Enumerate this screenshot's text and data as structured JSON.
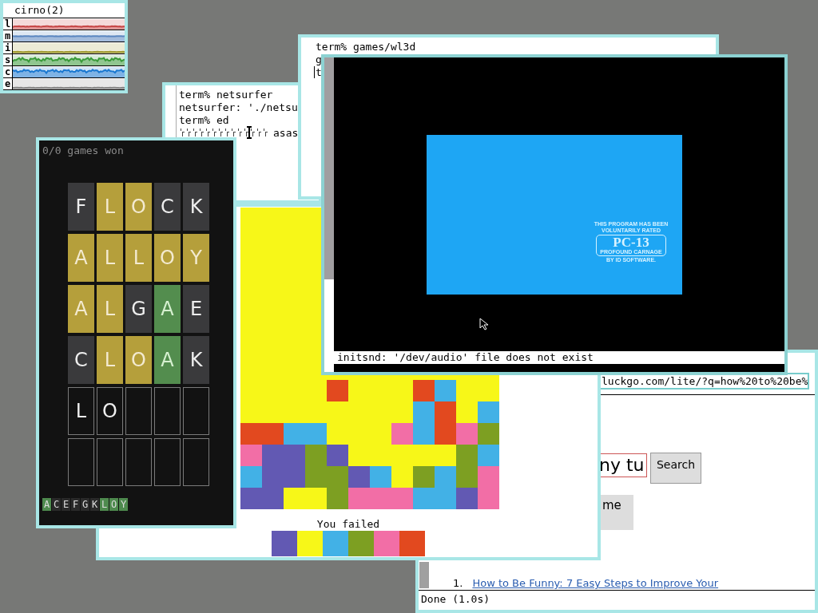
{
  "stats": {
    "title": "cirno(2)",
    "rows": [
      {
        "label": "l",
        "color": "#c84848"
      },
      {
        "label": "m",
        "color": "#5a86c0"
      },
      {
        "label": "i",
        "color": "#a09a30"
      },
      {
        "label": "s",
        "color": "#3a9a3a"
      },
      {
        "label": "c",
        "color": "#1a78d0"
      },
      {
        "label": "e",
        "color": "#888888"
      }
    ]
  },
  "terminals": [
    {
      "lines": [
        {
          "text": "term% netsurfer",
          "kind": "text"
        },
        {
          "text": "netsurfer: './netsu",
          "kind": "text"
        },
        {
          "text": "term% ed",
          "kind": "text"
        },
        {
          "text": "asas",
          "kind": "garbled",
          "cursor": true
        }
      ]
    },
    {
      "lines": [
        {
          "text": "term% games/wl3d",
          "kind": "text"
        },
        {
          "text": "g",
          "kind": "text"
        },
        {
          "text": "t",
          "kind": "text",
          "cursor": true
        }
      ]
    }
  ],
  "browser": {
    "url": "luckgo.com/lite/?q=how%20to%20be%",
    "search_value": "ny tu",
    "search_button": "Search",
    "button_2": "me",
    "results": [
      {
        "number": "1.",
        "title": "How to Be Funny: 7 Easy Steps to Improve Your"
      }
    ],
    "status": "Done (1.0s)"
  },
  "flood": {
    "board": {
      "color": "#f7f718",
      "rows": [
        [
          null,
          null,
          null,
          null,
          {
            "color": "#e2491f"
          },
          null,
          null,
          null,
          {
            "color": "#e2491f"
          },
          {
            "color": "#42b1e6"
          },
          null,
          null
        ],
        [
          null,
          null,
          null,
          null,
          null,
          null,
          null,
          null,
          {
            "color": "#42b1e6"
          },
          {
            "color": "#e2491f"
          },
          null,
          {
            "color": "#42b1e6"
          }
        ],
        [
          {
            "color": "#e2491f"
          },
          {
            "color": "#e2491f"
          },
          {
            "color": "#42b1e6"
          },
          {
            "color": "#42b1e6"
          },
          null,
          null,
          null,
          {
            "color": "#f26ea6"
          },
          {
            "color": "#42b1e6"
          },
          {
            "color": "#e2491f"
          },
          {
            "color": "#f26ea6"
          },
          {
            "color": "#7d9f22"
          }
        ],
        [
          {
            "color": "#f26ea6"
          },
          {
            "color": "#6259b3"
          },
          {
            "color": "#6259b3"
          },
          {
            "color": "#7d9f22"
          },
          {
            "color": "#6259b3"
          },
          null,
          null,
          null,
          null,
          null,
          {
            "color": "#7d9f22"
          },
          {
            "color": "#42b1e6"
          }
        ],
        [
          {
            "color": "#42b1e6"
          },
          {
            "color": "#6259b3"
          },
          {
            "color": "#6259b3"
          },
          {
            "color": "#7d9f22"
          },
          {
            "color": "#7d9f22"
          },
          {
            "color": "#6259b3"
          },
          {
            "color": "#42b1e6"
          },
          null,
          {
            "color": "#7d9f22"
          },
          {
            "color": "#42b1e6"
          },
          {
            "color": "#7d9f22"
          },
          {
            "color": "#f26ea6"
          }
        ],
        [
          {
            "color": "#6259b3"
          },
          {
            "color": "#6259b3"
          },
          null,
          null,
          {
            "color": "#7d9f22"
          },
          {
            "color": "#f26ea6"
          },
          {
            "color": "#f26ea6"
          },
          {
            "color": "#f26ea6"
          },
          {
            "color": "#42b1e6"
          },
          {
            "color": "#42b1e6"
          },
          {
            "color": "#6259b3"
          },
          {
            "color": "#f26ea6"
          }
        ]
      ]
    },
    "message": "You failed",
    "palette": [
      {
        "color": "#6259b3"
      },
      {
        "color": "#f7f718"
      },
      {
        "color": "#42b1e6"
      },
      {
        "color": "#7d9f22"
      },
      {
        "color": "#f26ea6"
      },
      {
        "color": "#e2491f"
      }
    ]
  },
  "wordle": {
    "score": "0/0 games won",
    "rows": [
      [
        {
          "letter": "F",
          "kind": "absent"
        },
        {
          "letter": "L",
          "kind": "present"
        },
        {
          "letter": "O",
          "kind": "present"
        },
        {
          "letter": "C",
          "kind": "absent"
        },
        {
          "letter": "K",
          "kind": "absent"
        }
      ],
      [
        {
          "letter": "A",
          "kind": "present"
        },
        {
          "letter": "L",
          "kind": "present"
        },
        {
          "letter": "L",
          "kind": "present"
        },
        {
          "letter": "O",
          "kind": "present"
        },
        {
          "letter": "Y",
          "kind": "present"
        }
      ],
      [
        {
          "letter": "A",
          "kind": "present"
        },
        {
          "letter": "L",
          "kind": "present"
        },
        {
          "letter": "G",
          "kind": "absent"
        },
        {
          "letter": "A",
          "kind": "correct"
        },
        {
          "letter": "E",
          "kind": "absent"
        }
      ],
      [
        {
          "letter": "C",
          "kind": "absent"
        },
        {
          "letter": "L",
          "kind": "present"
        },
        {
          "letter": "O",
          "kind": "present"
        },
        {
          "letter": "A",
          "kind": "correct"
        },
        {
          "letter": "K",
          "kind": "absent"
        }
      ],
      [
        {
          "letter": "L",
          "kind": "typed"
        },
        {
          "letter": "O",
          "kind": "typed"
        },
        {
          "kind": "empty"
        },
        {
          "kind": "empty"
        },
        {
          "kind": "empty"
        }
      ],
      [
        {
          "kind": "empty"
        },
        {
          "kind": "empty"
        },
        {
          "kind": "empty"
        },
        {
          "kind": "empty"
        },
        {
          "kind": "empty"
        }
      ]
    ],
    "keys": [
      {
        "letter": "A",
        "highlighted": true
      },
      {
        "letter": "C",
        "highlighted": false
      },
      {
        "letter": "E",
        "highlighted": false
      },
      {
        "letter": "F",
        "highlighted": false
      },
      {
        "letter": "G",
        "highlighted": false
      },
      {
        "letter": "K",
        "highlighted": false
      },
      {
        "letter": "L",
        "highlighted": true
      },
      {
        "letter": "O",
        "highlighted": true
      },
      {
        "letter": "Y",
        "highlighted": true
      }
    ]
  },
  "game": {
    "rating": {
      "lines": [
        "THIS PROGRAM HAS BEEN",
        "VOLUNTARILY RATED"
      ],
      "rating": "PC-13",
      "descriptor": "PROFOUND CARNAGE",
      "footer": "BY ID SOFTWARE."
    },
    "message": "initsnd: '/dev/audio' file does not exist"
  }
}
